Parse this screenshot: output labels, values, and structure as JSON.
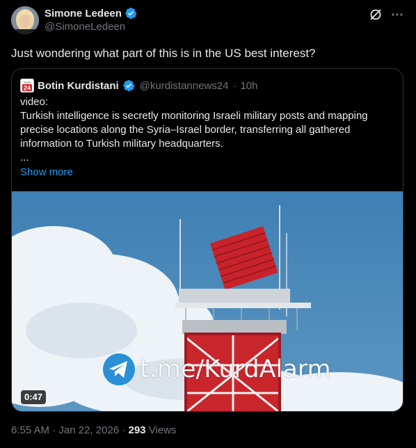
{
  "author": {
    "name": "Simone Ledeen",
    "handle": "@SimoneLedeen",
    "verified": true
  },
  "tweet_text": "Just wondering what part of this is in the US best interest?",
  "quoted": {
    "name": "Botin Kurdistani",
    "handle": "@kurdistannews24",
    "separator": "·",
    "time": "10h",
    "logo_text": "24",
    "logo_top_text": "news",
    "body": "video:\nTurkish intelligence is secretly monitoring Israeli military posts and mapping precise locations along the Syria–Israel border, transferring all gathered information to Turkish military headquarters.\n...",
    "show_more": "Show more",
    "video": {
      "duration": "0:47",
      "watermark": "t.me/KurdAlarm"
    }
  },
  "footer": {
    "time": "6:55 AM",
    "separator1": "·",
    "date": "Jan 22, 2026",
    "separator2": "·",
    "views_count": "293",
    "views_label": "Views"
  },
  "icons": {
    "grok": "grok-icon",
    "more": "more-icon",
    "verified_color": "#1d9bf0"
  }
}
